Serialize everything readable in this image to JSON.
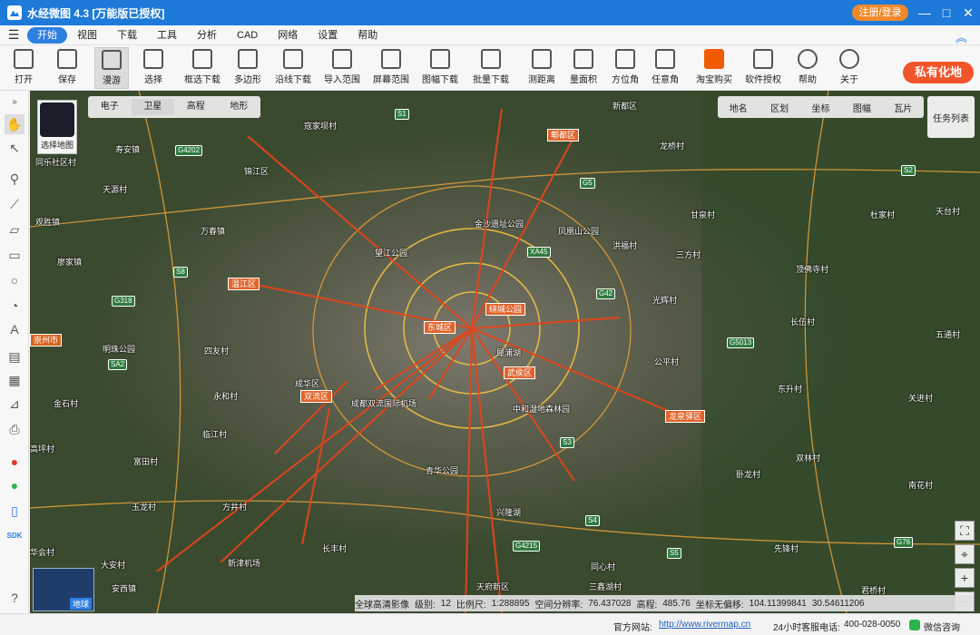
{
  "app": {
    "title": "水经微图 4.3 [万能版已授权]",
    "login": "注册/登录"
  },
  "window": {
    "minimize": "—",
    "maximize": "□",
    "close": "✕",
    "extra": "⋯"
  },
  "menu": {
    "items": [
      "开始",
      "视图",
      "下载",
      "工具",
      "分析",
      "CAD",
      "网络",
      "设置",
      "帮助"
    ],
    "active": "开始"
  },
  "toolbar": {
    "items": [
      "打开",
      "保存",
      "漫游",
      "选择",
      "框选下载",
      "多边形",
      "沿线下载",
      "导入范围",
      "屏幕范围",
      "图幅下载",
      "批量下载",
      "测距离",
      "量面积",
      "方位角",
      "任意角",
      "淘宝购买",
      "软件授权",
      "帮助",
      "关于"
    ],
    "pressed": "漫游",
    "private": "私有化地"
  },
  "map": {
    "select_map": "选择地图",
    "types": [
      "电子",
      "卫星",
      "高程",
      "地形"
    ],
    "active_type": "卫星",
    "layers": [
      "地名",
      "区划",
      "坐标",
      "图幅",
      "瓦片"
    ],
    "task_list": "任务列表",
    "globe": "地球",
    "places": [
      "寇家坝村",
      "寿安镇",
      "天源村",
      "观胜镇",
      "廖家镇",
      "万春镇",
      "同乐社区村",
      "温江区",
      "明珠公园",
      "崇州市",
      "四友村",
      "永和村",
      "金石村",
      "临江村",
      "高坪村",
      "富田村",
      "玉龙村",
      "方井村",
      "大安村",
      "安西镇",
      "华会村",
      "新津机场",
      "双流区",
      "成都双流国际机场",
      "中和湿地森林园",
      "龙泉驿区",
      "新都区",
      "龙桥村",
      "甘泉村",
      "三方村",
      "洪福村",
      "光辉村",
      "长伍村",
      "公平村",
      "顶佛寺村",
      "杜家村",
      "东升村",
      "双林村",
      "卧龙村",
      "同心村",
      "三鑫湖村",
      "先锋村",
      "君桥村",
      "天台村",
      "五通村",
      "关进村",
      "南花村",
      "长丰村",
      "郫都区",
      "锦江区",
      "武侯区",
      "东城区",
      "成华区",
      "绕城公园",
      "青华公园",
      "凤凰山公园",
      "金沙遗址公园",
      "望江公园",
      "犀浦湖",
      "兴隆湖",
      "天府新区"
    ],
    "highways": [
      "S1",
      "G5",
      "G4202",
      "XA45",
      "G42",
      "G5013",
      "S2",
      "S3",
      "S4",
      "S5",
      "G76",
      "S8",
      "G318",
      "SA2",
      "G4215"
    ],
    "status": {
      "source": "全球高清影像",
      "level_label": "级别:",
      "level": "12",
      "scale_label": "比例尺:",
      "scale": "1:288895",
      "resolution_label": "空间分辨率:",
      "resolution": "76.437028",
      "elevation_label": "高程:",
      "elevation": "485.76",
      "coord_label": "坐标无偏移:",
      "lon": "104.11399841",
      "lat": "30.54611206"
    }
  },
  "footer": {
    "website_label": "官方网站:",
    "website": "http://www.rivermap.cn",
    "hotline_label": "24小时客服电话:",
    "hotline": "400-028-0050",
    "wechat": "微信咨询"
  }
}
